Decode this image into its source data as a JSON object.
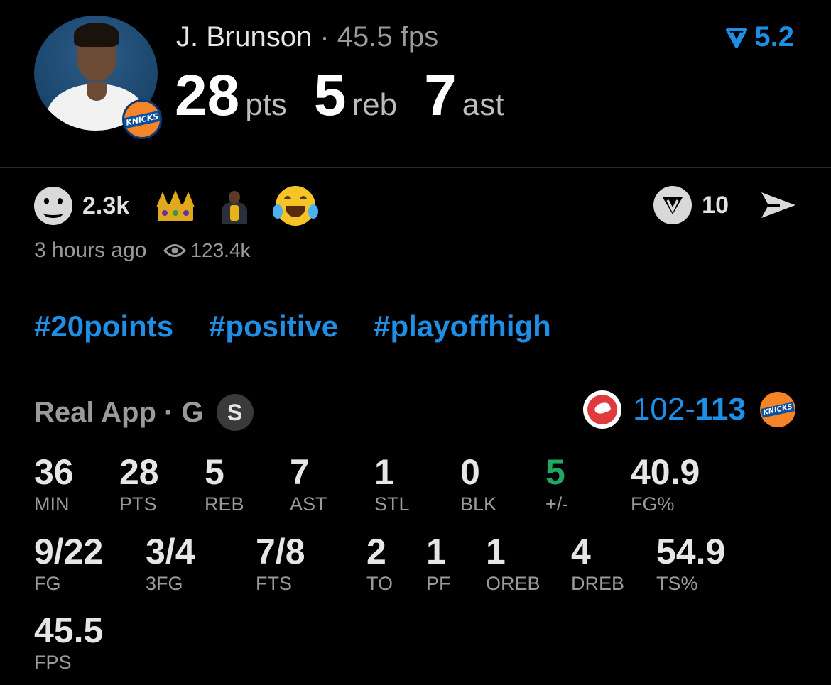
{
  "header": {
    "player_name": "J. Brunson",
    "separator": "·",
    "fps_text": "45.5 fps",
    "points": "28",
    "points_unit": "pts",
    "rebounds": "5",
    "rebounds_unit": "reb",
    "assists": "7",
    "assists_unit": "ast",
    "score_value": "5.2",
    "team_badge_text": "KNICKS"
  },
  "reactions": {
    "count": "2.3k",
    "share_count": "10",
    "time_ago": "3 hours ago",
    "views": "123.4k"
  },
  "hashtags": [
    "#20points",
    "#positive",
    "#playoffhigh"
  ],
  "source": {
    "label": "Real App · G",
    "badge": "S"
  },
  "game": {
    "opponent_score": "102",
    "dash": "-",
    "team_score": "113"
  },
  "stats": [
    {
      "value": "36",
      "label": "MIN"
    },
    {
      "value": "28",
      "label": "PTS"
    },
    {
      "value": "5",
      "label": "REB"
    },
    {
      "value": "7",
      "label": "AST"
    },
    {
      "value": "1",
      "label": "STL"
    },
    {
      "value": "0",
      "label": "BLK"
    },
    {
      "value": "5",
      "label": "+/-"
    },
    {
      "value": "40.9",
      "label": "FG%"
    },
    {
      "value": "9/22",
      "label": "FG"
    },
    {
      "value": "3/4",
      "label": "3FG"
    },
    {
      "value": "7/8",
      "label": "FTS"
    },
    {
      "value": "2",
      "label": "TO"
    },
    {
      "value": "1",
      "label": "PF"
    },
    {
      "value": "1",
      "label": "OREB"
    },
    {
      "value": "4",
      "label": "DREB"
    },
    {
      "value": "54.9",
      "label": "TS%"
    },
    {
      "value": "45.5",
      "label": "FPS"
    }
  ],
  "colors": {
    "accent_blue": "#1f8fe6",
    "positive_green": "#20a862",
    "background": "#000000"
  },
  "icons": [
    "player-avatar",
    "knicks-logo-icon",
    "v-logo-icon",
    "smile-icon",
    "crown-icon",
    "player-emoji-icon",
    "laughing-emoji-icon",
    "share-arrow-icon",
    "eye-icon",
    "hawks-logo-icon"
  ]
}
